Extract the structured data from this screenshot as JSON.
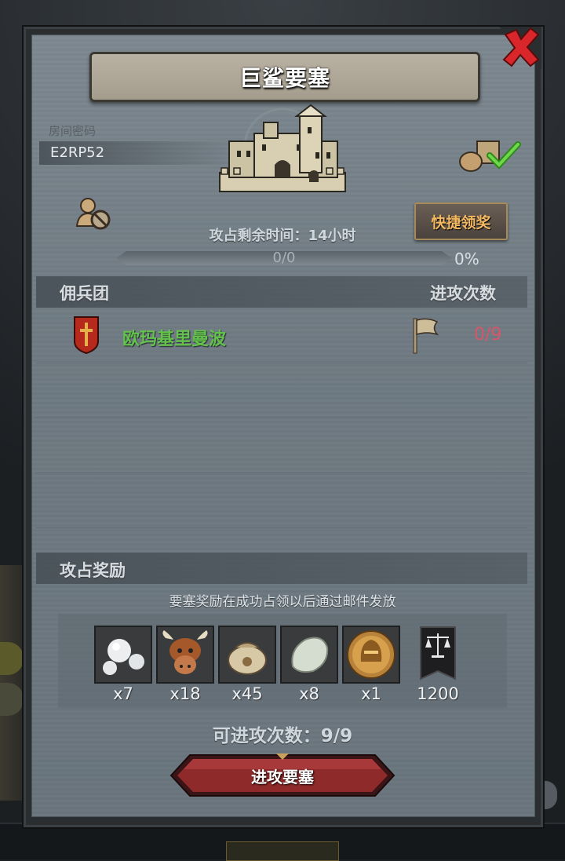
{
  "dialog": {
    "title": "巨鲨要塞",
    "room_code_label": "房间密码",
    "room_code": "E2RP52",
    "quick_claim_label": "快捷领奖",
    "time_remaining": "攻占剩余时间：14小时",
    "progress_text": "0/0",
    "progress_percent_label": "0%",
    "progress_fraction": 0
  },
  "mercenary": {
    "section_label": "佣兵团",
    "attack_count_header": "进攻次数",
    "rows": [
      {
        "name": "欧玛基里曼波",
        "attacks": "0/9"
      }
    ]
  },
  "rewards": {
    "section_label": "攻占奖励",
    "note": "要塞奖励在成功占领以后通过邮件发放",
    "items": [
      {
        "icon": "pearls-icon",
        "qty": "x7"
      },
      {
        "icon": "cow-icon",
        "qty": "x18"
      },
      {
        "icon": "grain-sack-icon",
        "qty": "x45"
      },
      {
        "icon": "white-stone-icon",
        "qty": "x8"
      },
      {
        "icon": "golden-helmet-icon",
        "qty": "x1"
      },
      {
        "icon": "justice-banner-icon",
        "qty": "1200"
      }
    ]
  },
  "footer": {
    "remaining_attacks": "可进攻次数：9/9",
    "attack_button_label": "进攻要塞"
  },
  "colors": {
    "merc_name": "#62c24a",
    "attack_count": "#d6576a",
    "quick_claim_text": "#f3b862",
    "close_x": "#d8262b"
  }
}
